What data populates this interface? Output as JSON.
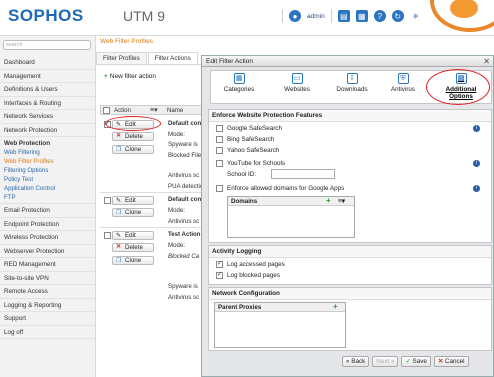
{
  "header": {
    "brand": "SOPHOS",
    "product": "UTM 9",
    "user": "admin"
  },
  "sidebar": {
    "search_placeholder": "search",
    "items": [
      "Dashboard",
      "Management",
      "Definitions & Users",
      "Interfaces & Routing",
      "Network Services",
      "Network Protection"
    ],
    "web_protection": {
      "label": "Web Protection",
      "subitems": [
        "Web Filtering",
        "Web Filter Profiles",
        "Filtering Options",
        "Policy Test",
        "Application Control",
        "FTP"
      ]
    },
    "items2": [
      "Email Protection",
      "Endpoint Protection",
      "Wireless Protection",
      "Webserver Protection",
      "RED Management",
      "Site-to-site VPN",
      "Remote Access",
      "Logging & Reporting",
      "Support",
      "Log off"
    ]
  },
  "breadcrumb": "Web Filter Profiles",
  "tabs": [
    "Filter Profiles",
    "Filter Actions"
  ],
  "list": {
    "new_button": "New filter action",
    "col_action": "Action",
    "col_name": "Name",
    "btn_edit": "Edit",
    "btn_delete": "Delete",
    "btn_clone": "Clone",
    "row1": {
      "name": "Default con",
      "lines": [
        "Mode:",
        "Spyware is",
        "Blocked File",
        "Antivirus sc",
        "PUA detection"
      ]
    },
    "row2": {
      "name": "Default con",
      "lines": [
        "Mode:",
        "Antivirus sc"
      ]
    },
    "row3": {
      "name": "Test Action",
      "lines": [
        "Mode:",
        "Blocked Ca",
        "Spyware is",
        "Antivirus sc"
      ]
    }
  },
  "dialog": {
    "title": "Edit Filter Action",
    "tools": [
      "Categories",
      "Websites",
      "Downloads",
      "Antivirus",
      "Additional Options"
    ],
    "enforce": {
      "title": "Enforce Website Protection Features",
      "google": "Google SafeSearch",
      "bing": "Bing SafeSearch",
      "yahoo": "Yahoo SafeSearch",
      "youtube": "YouTube for Schools",
      "school_id": "School ID:",
      "enforce_domains": "Enforce allowed domains for Google Apps",
      "domains_header": "Domains"
    },
    "logging": {
      "title": "Activity Logging",
      "accessed": "Log accessed pages",
      "blocked": "Log blocked pages"
    },
    "network": {
      "title": "Network Configuration",
      "parent": "Parent Proxies"
    },
    "buttons": {
      "back": "Back",
      "next": "Next",
      "save": "Save",
      "cancel": "Cancel"
    }
  },
  "colors": {
    "accent": "#e07b16",
    "brand": "#1f6ab5"
  }
}
